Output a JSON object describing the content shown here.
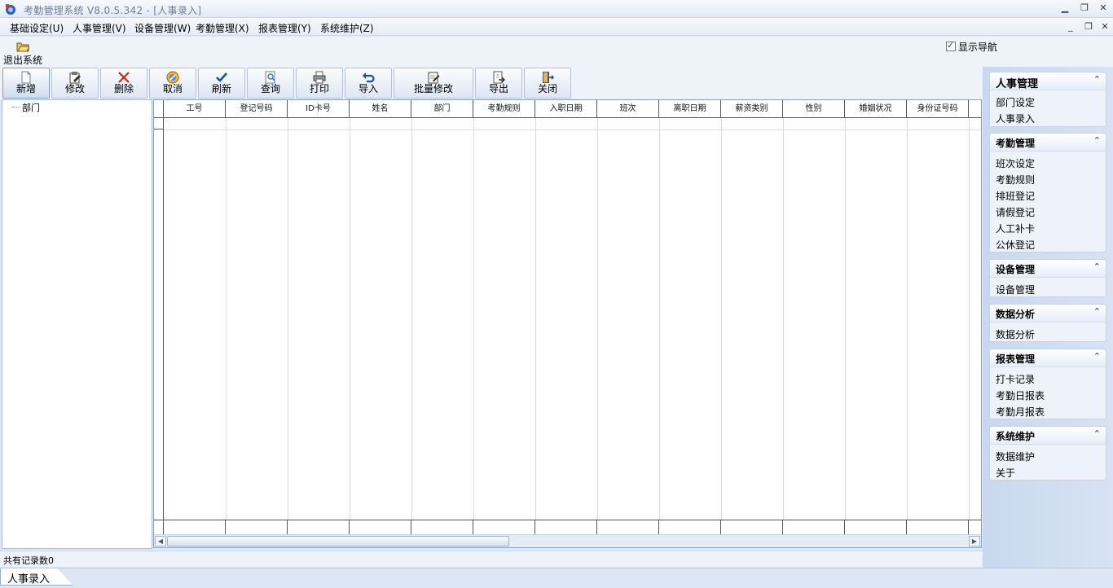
{
  "window": {
    "title": "考勤管理系统 V8.0.5.342 - [人事录入]",
    "controls": [
      "▁",
      "❐",
      "✕"
    ],
    "mdi_controls": [
      "_",
      "❐",
      "✕"
    ]
  },
  "menubar": {
    "items": [
      "基础设定(U)",
      "人事管理(V)",
      "设备管理(W)",
      "考勤管理(X)",
      "报表管理(Y)",
      "系统维护(Z)"
    ]
  },
  "exit": {
    "label": "退出系统"
  },
  "show_nav": {
    "label": "显示导航",
    "checked": true
  },
  "toolbar": {
    "buttons": [
      "新增",
      "修改",
      "删除",
      "取消",
      "刷新",
      "查询",
      "打印",
      "导入",
      "批量修改",
      "导出",
      "关闭"
    ]
  },
  "tree": {
    "root": "部门"
  },
  "grid": {
    "columns": [
      "工号",
      "登记号码",
      "ID卡号",
      "姓名",
      "部门",
      "考勤规则",
      "入职日期",
      "班次",
      "离职日期",
      "薪资类别",
      "性别",
      "婚姻状况",
      "身份证号码"
    ]
  },
  "status": {
    "text": "共有记录数0"
  },
  "tabs": [
    "人事录入"
  ],
  "nav": {
    "groups": [
      {
        "title": "人事管理",
        "items": [
          "部门设定",
          "人事录入"
        ]
      },
      {
        "title": "考勤管理",
        "items": [
          "班次设定",
          "考勤规则",
          "排班登记",
          "请假登记",
          "人工补卡",
          "公休登记"
        ]
      },
      {
        "title": "设备管理",
        "items": [
          "设备管理"
        ]
      },
      {
        "title": "数据分析",
        "items": [
          "数据分析"
        ]
      },
      {
        "title": "报表管理",
        "items": [
          "打卡记录",
          "考勤日报表",
          "考勤月报表"
        ]
      },
      {
        "title": "系统维护",
        "items": [
          "数据维护",
          "关于"
        ]
      }
    ]
  }
}
